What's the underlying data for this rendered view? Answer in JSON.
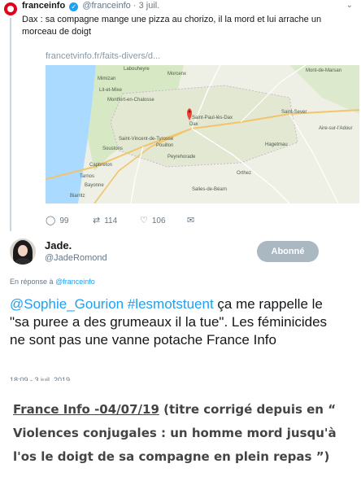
{
  "quoted_tweet": {
    "account_name": "franceinfo",
    "handle": "@franceinfo",
    "separator": "·",
    "date": "3 juil.",
    "text": "Dax : sa compagne mange une pizza au chorizo, il la mord et lui arrache un morceau de doigt",
    "link": "francetvinfo.fr/faits-divers/d...",
    "map_labels": [
      "Montfort-en-Chalosse",
      "Saint-Paul-lès-Dax",
      "Dax",
      "Saint-Vincent-de-Tyrosse",
      "Bayonne",
      "Biarritz",
      "Peyrehorade",
      "Mont-de-Marsan",
      "Orthez",
      "Hagetmau",
      "Aire-sur-l'Adour",
      "Salies-de-Béarn",
      "Morcenx",
      "Saint-Sever",
      "Labouheyre",
      "Mimizan",
      "Lit-et-Mixe",
      "Soustons",
      "Capbreton",
      "Tarnos",
      "Pouillon"
    ],
    "replies": "99",
    "retweets": "114",
    "likes": "106"
  },
  "reply_tweet": {
    "name": "Jade.",
    "handle": "@JadeRomond",
    "follow_button": "Abonné",
    "reply_prefix": "En réponse à",
    "reply_to": "@franceinfo",
    "mentions": "@Sophie_Gourion #lesmotstuent",
    "text": " ça me rappelle le \"sa puree a des grumeaux il la tue\". Les féminicides ne sont pas une vanne potache France Info",
    "timestamp": "18:09 - 3 juil. 2019"
  },
  "caption": {
    "underlined": "France Info -04/07/19",
    "text": " (titre corrigé depuis en “ Violences conjugales : un homme mord jusqu'à l'os le doigt de sa compagne en plein repas ”)"
  },
  "colors": {
    "link_blue": "#1da1f2",
    "muted_gray": "#657786",
    "franceinfo_red": "#e2001a",
    "button_gray": "#aab8c2",
    "caption_text": "#444444"
  }
}
